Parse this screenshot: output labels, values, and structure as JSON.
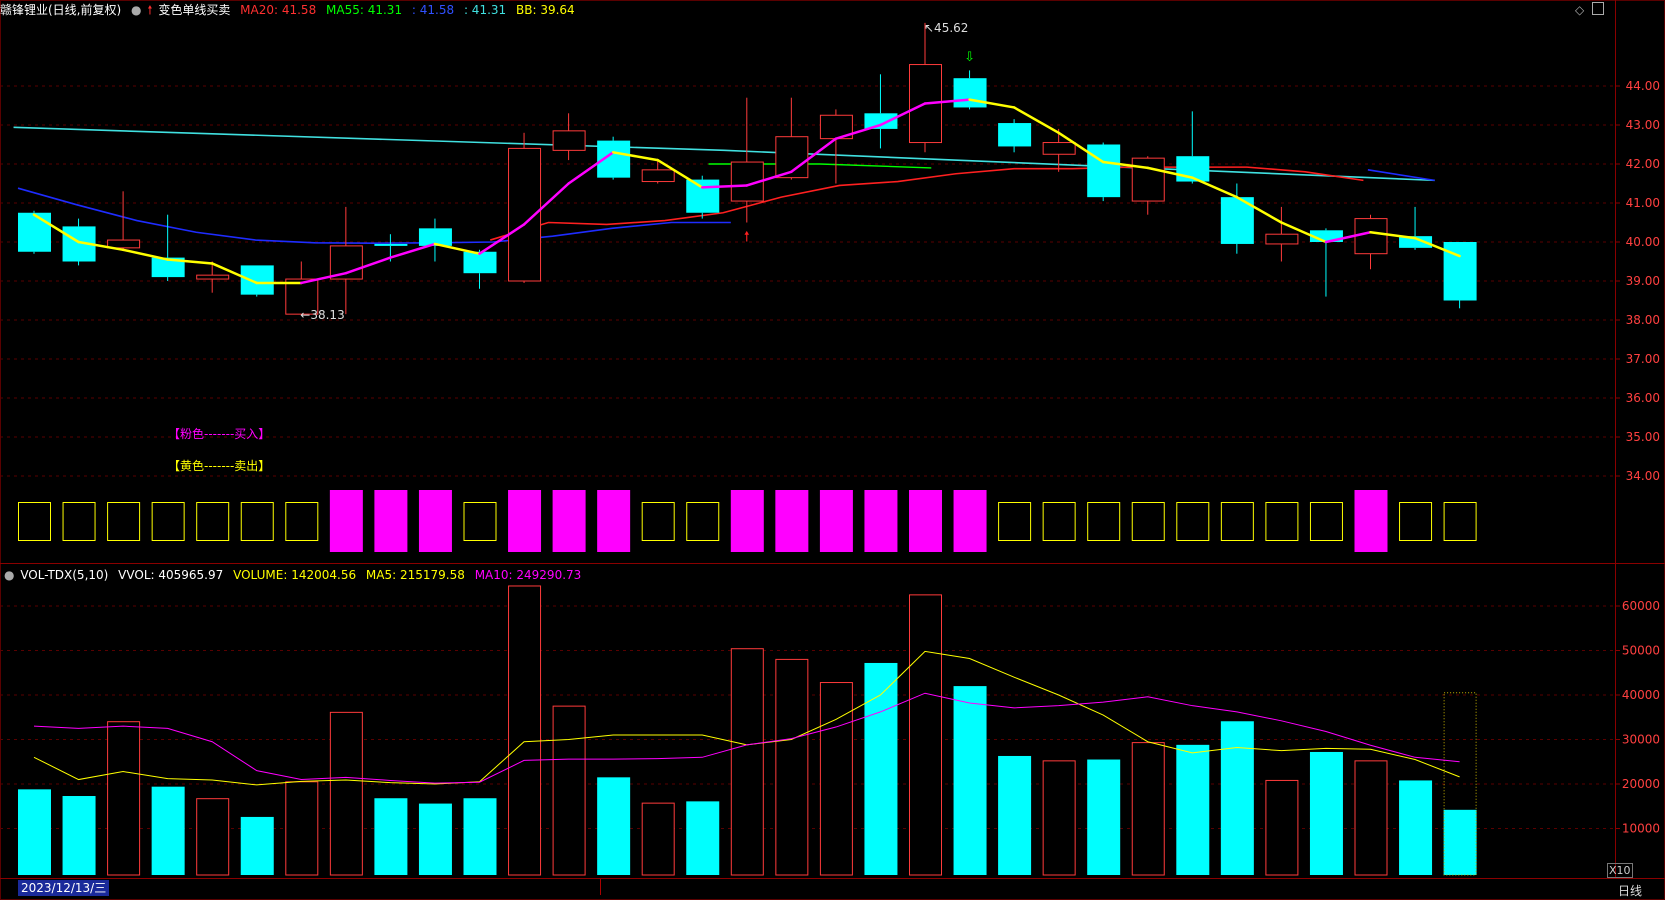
{
  "colors": {
    "bg": "#000000",
    "grid": "#5a0000",
    "up": "#ff3b3b",
    "down": "#00ffff",
    "yellow": "#ffff00",
    "magenta": "#ff00ff",
    "red_ma": "#ff2020",
    "blue_ma": "#1e2cff",
    "cyan_ma": "#40e0e0",
    "green": "#00ff00",
    "axis_text": "#ff4040"
  },
  "header": {
    "title": "赣锋锂业(日线,前复权)",
    "indicator": "变色单线买卖",
    "ma20_label": "MA20: 41.58",
    "ma55_label": "MA55: 41.31",
    "extra1_label": ": 41.58",
    "extra2_label": ": 41.31",
    "bb_label": "BB: 39.64"
  },
  "vol_header": {
    "name": "VOL-TDX(5,10)",
    "vvol": "VVOL: 405965.97",
    "volume": "VOLUME: 142004.56",
    "ma5": "MA5: 215179.58",
    "ma10": "MA10: 249290.73"
  },
  "legend": {
    "buy": "【粉色-------买入】",
    "sell": "【黄色-------卖出】"
  },
  "annotations": {
    "high": "45.62",
    "low": "38.13"
  },
  "footer": {
    "date": "2023/12/13/三",
    "period": "日线",
    "zoom": "X10"
  },
  "chart_data": [
    {
      "type": "candlestick",
      "price_axis": {
        "ticks": [
          "44.00",
          "43.00",
          "42.00",
          "41.00",
          "40.00",
          "39.00",
          "38.00",
          "37.00",
          "36.00",
          "35.00",
          "34.00"
        ],
        "range": [
          33.2,
          45.8
        ]
      },
      "candles": [
        {
          "o": 40.75,
          "h": 40.8,
          "l": 39.7,
          "c": 39.75
        },
        {
          "o": 40.4,
          "h": 40.6,
          "l": 39.4,
          "c": 39.5
        },
        {
          "o": 39.85,
          "h": 41.3,
          "l": 39.8,
          "c": 40.05
        },
        {
          "o": 39.6,
          "h": 40.7,
          "l": 39.0,
          "c": 39.1
        },
        {
          "o": 39.05,
          "h": 39.5,
          "l": 38.7,
          "c": 39.15
        },
        {
          "o": 39.4,
          "h": 39.4,
          "l": 38.6,
          "c": 38.65
        },
        {
          "o": 38.15,
          "h": 39.5,
          "l": 38.13,
          "c": 39.05
        },
        {
          "o": 39.05,
          "h": 40.9,
          "l": 38.15,
          "c": 39.9
        },
        {
          "o": 39.95,
          "h": 40.2,
          "l": 39.5,
          "c": 39.9
        },
        {
          "o": 40.35,
          "h": 40.6,
          "l": 39.5,
          "c": 39.9
        },
        {
          "o": 39.75,
          "h": 39.8,
          "l": 38.8,
          "c": 39.2
        },
        {
          "o": 39.0,
          "h": 42.8,
          "l": 38.95,
          "c": 42.4
        },
        {
          "o": 42.35,
          "h": 43.3,
          "l": 42.1,
          "c": 42.85
        },
        {
          "o": 42.6,
          "h": 42.7,
          "l": 41.6,
          "c": 41.65
        },
        {
          "o": 41.55,
          "h": 42.1,
          "l": 41.5,
          "c": 41.85
        },
        {
          "o": 41.6,
          "h": 41.7,
          "l": 40.6,
          "c": 40.75
        },
        {
          "o": 41.05,
          "h": 43.7,
          "l": 40.5,
          "c": 42.05
        },
        {
          "o": 41.65,
          "h": 43.7,
          "l": 41.6,
          "c": 42.7
        },
        {
          "o": 42.65,
          "h": 43.4,
          "l": 41.5,
          "c": 43.25
        },
        {
          "o": 43.3,
          "h": 44.3,
          "l": 42.4,
          "c": 42.9
        },
        {
          "o": 42.55,
          "h": 45.62,
          "l": 42.3,
          "c": 44.55
        },
        {
          "o": 44.2,
          "h": 44.4,
          "l": 43.4,
          "c": 43.45
        },
        {
          "o": 43.05,
          "h": 43.15,
          "l": 42.3,
          "c": 42.45
        },
        {
          "o": 42.25,
          "h": 42.9,
          "l": 41.8,
          "c": 42.55
        },
        {
          "o": 42.5,
          "h": 42.55,
          "l": 41.05,
          "c": 41.15
        },
        {
          "o": 41.05,
          "h": 42.2,
          "l": 40.7,
          "c": 42.15
        },
        {
          "o": 42.2,
          "h": 43.35,
          "l": 41.5,
          "c": 41.55
        },
        {
          "o": 41.15,
          "h": 41.5,
          "l": 39.7,
          "c": 39.95
        },
        {
          "o": 39.95,
          "h": 40.9,
          "l": 39.5,
          "c": 40.2
        },
        {
          "o": 40.3,
          "h": 40.35,
          "l": 38.6,
          "c": 40.0
        },
        {
          "o": 39.7,
          "h": 40.7,
          "l": 39.3,
          "c": 40.6
        },
        {
          "o": 40.15,
          "h": 40.9,
          "l": 39.8,
          "c": 39.85
        },
        {
          "o": 40.0,
          "h": 40.0,
          "l": 38.3,
          "c": 38.5
        }
      ],
      "signal_line": [
        40.7,
        40.0,
        39.8,
        39.55,
        39.45,
        38.95,
        38.95,
        39.2,
        39.6,
        39.95,
        39.7,
        40.45,
        41.5,
        42.3,
        42.1,
        41.4,
        41.45,
        41.8,
        42.65,
        43.0,
        43.55,
        43.65,
        43.45,
        42.8,
        42.05,
        41.9,
        41.65,
        41.15,
        40.5,
        40.0,
        40.25,
        40.1,
        39.64
      ],
      "signal_colors": [
        "yellow",
        "yellow",
        "yellow",
        "yellow",
        "yellow",
        "yellow",
        "yellow",
        "magenta",
        "magenta",
        "magenta",
        "yellow",
        "magenta",
        "magenta",
        "magenta",
        "yellow",
        "yellow",
        "magenta",
        "magenta",
        "magenta",
        "magenta",
        "magenta",
        "magenta",
        "yellow",
        "yellow",
        "yellow",
        "yellow",
        "yellow",
        "yellow",
        "yellow",
        "yellow",
        "magenta",
        "yellow",
        "yellow"
      ],
      "ma_cyan": [
        41.58,
        42.94
      ],
      "ma_blue": [
        41.38,
        39.97
      ],
      "ma_red": [
        40.05,
        40.5,
        40.45,
        40.55,
        40.75,
        41.15,
        41.45,
        41.55,
        41.75,
        41.88,
        41.88,
        41.92,
        41.92,
        41.92,
        41.8,
        41.58
      ],
      "buy_sell_boxes": [
        "sell",
        "sell",
        "sell",
        "sell",
        "sell",
        "sell",
        "sell",
        "buy",
        "buy",
        "buy",
        "sell",
        "buy",
        "buy",
        "buy",
        "sell",
        "sell",
        "buy",
        "buy",
        "buy",
        "buy",
        "buy",
        "buy",
        "sell",
        "sell",
        "sell",
        "sell",
        "sell",
        "sell",
        "sell",
        "sell",
        "buy",
        "sell",
        "sell"
      ]
    },
    {
      "type": "bar",
      "series_name": "VOLUME",
      "axis": {
        "ticks": [
          "60000",
          "50000",
          "40000",
          "30000",
          "20000",
          "10000"
        ],
        "range": [
          0,
          66000
        ]
      },
      "volumes": [
        18800,
        17300,
        34000,
        19400,
        16700,
        12600,
        20500,
        36100,
        16800,
        15600,
        16800,
        64500,
        37500,
        21500,
        15700,
        16100,
        50400,
        48000,
        42800,
        47200,
        62500,
        42000,
        26300,
        25200,
        25500,
        29300,
        28800,
        34100,
        20800,
        27200,
        25200,
        20800,
        14200
      ],
      "volume_dir": [
        "down",
        "down",
        "up",
        "down",
        "up",
        "down",
        "up",
        "up",
        "down",
        "down",
        "down",
        "up",
        "up",
        "down",
        "up",
        "down",
        "up",
        "up",
        "up",
        "down",
        "up",
        "down",
        "down",
        "up",
        "down",
        "up",
        "down",
        "down",
        "up",
        "down",
        "up",
        "down",
        "down"
      ],
      "ma5": [
        26000,
        21000,
        22800,
        21200,
        20900,
        19800,
        20600,
        20900,
        20300,
        20000,
        20500,
        29500,
        30000,
        31000,
        31000,
        31000,
        28800,
        30000,
        34500,
        40000,
        49800,
        48200,
        44000,
        40000,
        35500,
        29500,
        27000,
        28200,
        27500,
        28000,
        27800,
        25500,
        21600
      ],
      "ma10": [
        33000,
        32500,
        33000,
        32500,
        29500,
        23000,
        21000,
        21500,
        20800,
        20200,
        20400,
        25300,
        25600,
        25600,
        25700,
        26000,
        28800,
        30200,
        32800,
        36200,
        40400,
        38200,
        37100,
        37600,
        38400,
        39600,
        37600,
        36200,
        34200,
        31800,
        28700,
        26000,
        25000
      ]
    }
  ]
}
